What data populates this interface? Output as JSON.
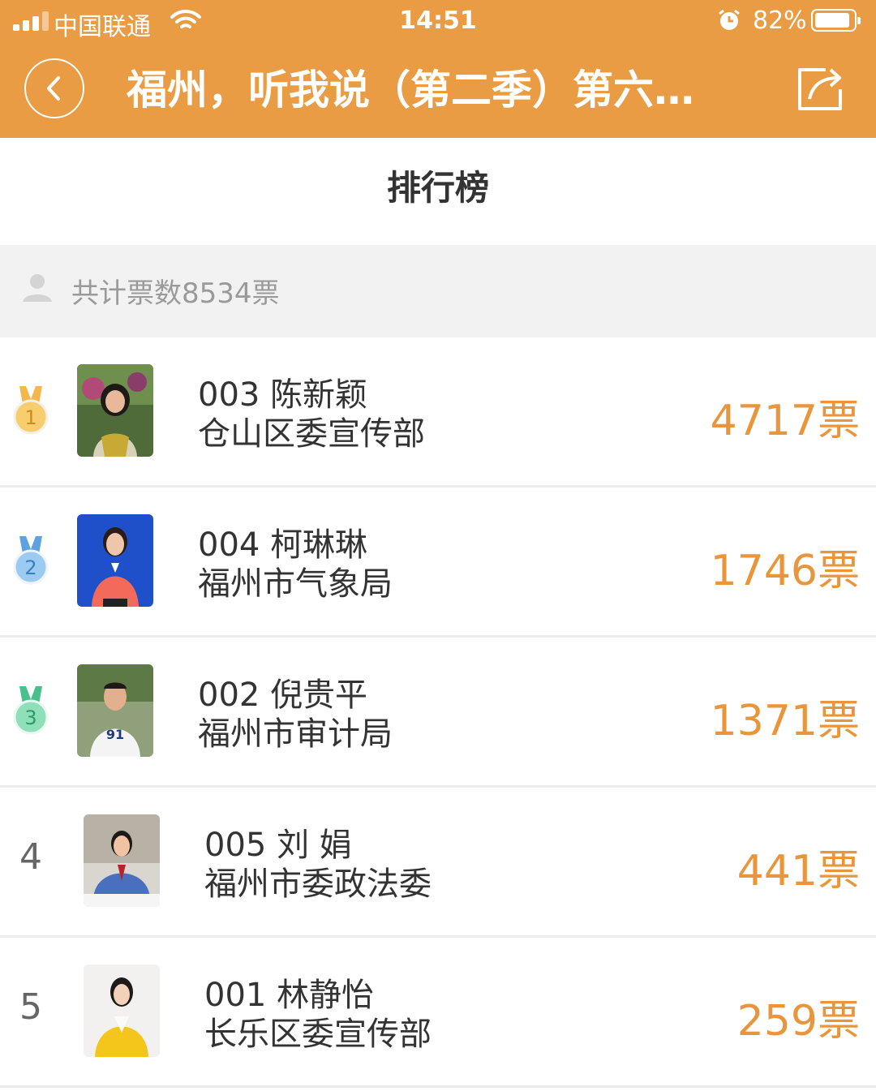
{
  "status_bar": {
    "carrier": "中国联通",
    "time": "14:51",
    "battery": "82%"
  },
  "nav": {
    "title": "福州，听我说（第二季）第六…",
    "back_icon": "chevron-left-icon",
    "share_icon": "share-icon"
  },
  "page": {
    "title": "排行榜"
  },
  "summary": {
    "text": "共计票数8534票"
  },
  "colors": {
    "brand": "#e99c43",
    "votes": "#e8953c",
    "gold": "#f4c15e",
    "silver": "#7cb6ea",
    "bronze": "#6fd3a4"
  },
  "ranking": [
    {
      "rank": "1",
      "line1": "003 陈新颖",
      "line2": "仓山区委宣传部",
      "votes": "4717票",
      "medal": "gold-medal-icon"
    },
    {
      "rank": "2",
      "line1": "004 柯琳琳",
      "line2": "福州市气象局",
      "votes": "1746票",
      "medal": "silver-medal-icon"
    },
    {
      "rank": "3",
      "line1": "002 倪贵平",
      "line2": "福州市审计局",
      "votes": "1371票",
      "medal": "bronze-medal-icon"
    },
    {
      "rank": "4",
      "line1": "005 刘 娟",
      "line2": "福州市委政法委",
      "votes": "441票"
    },
    {
      "rank": "5",
      "line1": "001 林静怡",
      "line2": "长乐区委宣传部",
      "votes": "259票"
    }
  ]
}
